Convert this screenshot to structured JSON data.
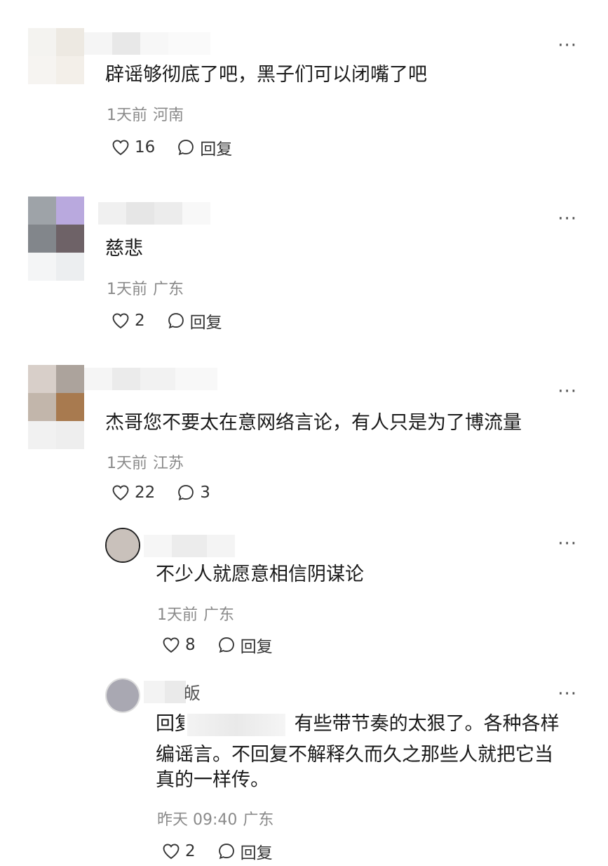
{
  "comments": [
    {
      "text": "辟谣够彻底了吧，黑子们可以闭嘴了吧",
      "time": "1天前",
      "location": "河南",
      "likes": "16",
      "reply_label": "回复"
    },
    {
      "text": "慈悲",
      "time": "1天前",
      "location": "广东",
      "likes": "2",
      "reply_label": "回复"
    },
    {
      "text": "杰哥您不要太在意网络言论，有人只是为了博流量",
      "time": "1天前",
      "location": "江苏",
      "likes": "22",
      "replies_count": "3"
    }
  ],
  "replies": [
    {
      "text": "不少人就愿意相信阴谋论",
      "time": "1天前",
      "location": "广东",
      "likes": "8",
      "reply_label": "回复"
    },
    {
      "name_suffix": "皈",
      "reply_prefix_a": "回",
      "reply_prefix_b": "复",
      "text_line1": "有些带节奏的太狠了。各种各样",
      "text_line2": "编谣言。不回复不解释久而久之那些人就把它当",
      "text_line3": "真的一样传。",
      "time": "昨天 09:40",
      "location": "广东",
      "likes": "2",
      "reply_label": "回复"
    }
  ],
  "more_label": "···",
  "icons": {
    "like": "heart-outline-icon",
    "comment": "speech-bubble-icon",
    "more": "more-dots-icon"
  }
}
